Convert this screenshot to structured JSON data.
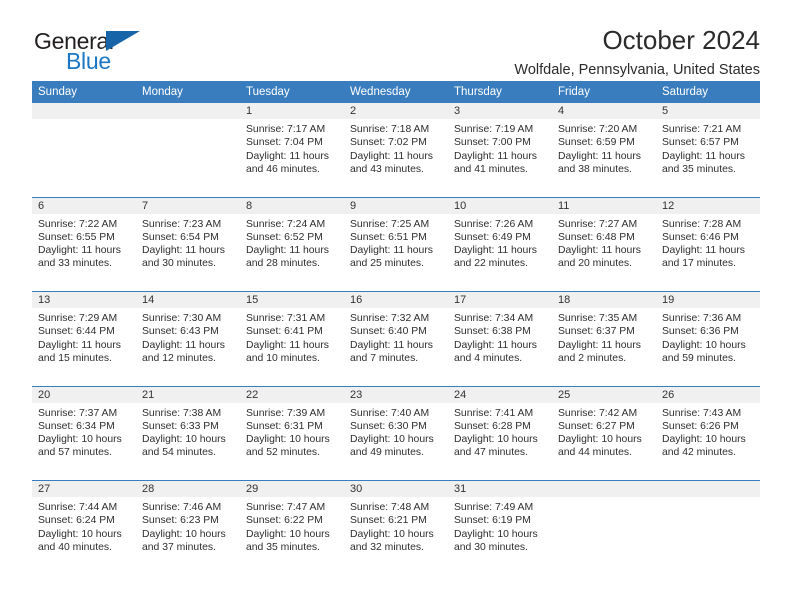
{
  "brand": {
    "name_top": "General",
    "name_bottom": "Blue",
    "accent_color": "#1b77c4",
    "triangle_color": "#1765a8"
  },
  "header": {
    "title": "October 2024",
    "subtitle": "Wolfdale, Pennsylvania, United States"
  },
  "calendar": {
    "header_bg": "#3a7dbe",
    "date_band_bg": "#f0f0f0",
    "weekdays": [
      "Sunday",
      "Monday",
      "Tuesday",
      "Wednesday",
      "Thursday",
      "Friday",
      "Saturday"
    ],
    "weeks": [
      [
        {
          "date": "",
          "empty": true,
          "sunrise": "",
          "sunset": "",
          "daylight1": "",
          "daylight2": ""
        },
        {
          "date": "",
          "empty": true,
          "sunrise": "",
          "sunset": "",
          "daylight1": "",
          "daylight2": ""
        },
        {
          "date": "1",
          "sunrise": "Sunrise: 7:17 AM",
          "sunset": "Sunset: 7:04 PM",
          "daylight1": "Daylight: 11 hours",
          "daylight2": "and 46 minutes."
        },
        {
          "date": "2",
          "sunrise": "Sunrise: 7:18 AM",
          "sunset": "Sunset: 7:02 PM",
          "daylight1": "Daylight: 11 hours",
          "daylight2": "and 43 minutes."
        },
        {
          "date": "3",
          "sunrise": "Sunrise: 7:19 AM",
          "sunset": "Sunset: 7:00 PM",
          "daylight1": "Daylight: 11 hours",
          "daylight2": "and 41 minutes."
        },
        {
          "date": "4",
          "sunrise": "Sunrise: 7:20 AM",
          "sunset": "Sunset: 6:59 PM",
          "daylight1": "Daylight: 11 hours",
          "daylight2": "and 38 minutes."
        },
        {
          "date": "5",
          "sunrise": "Sunrise: 7:21 AM",
          "sunset": "Sunset: 6:57 PM",
          "daylight1": "Daylight: 11 hours",
          "daylight2": "and 35 minutes."
        }
      ],
      [
        {
          "date": "6",
          "sunrise": "Sunrise: 7:22 AM",
          "sunset": "Sunset: 6:55 PM",
          "daylight1": "Daylight: 11 hours",
          "daylight2": "and 33 minutes."
        },
        {
          "date": "7",
          "sunrise": "Sunrise: 7:23 AM",
          "sunset": "Sunset: 6:54 PM",
          "daylight1": "Daylight: 11 hours",
          "daylight2": "and 30 minutes."
        },
        {
          "date": "8",
          "sunrise": "Sunrise: 7:24 AM",
          "sunset": "Sunset: 6:52 PM",
          "daylight1": "Daylight: 11 hours",
          "daylight2": "and 28 minutes."
        },
        {
          "date": "9",
          "sunrise": "Sunrise: 7:25 AM",
          "sunset": "Sunset: 6:51 PM",
          "daylight1": "Daylight: 11 hours",
          "daylight2": "and 25 minutes."
        },
        {
          "date": "10",
          "sunrise": "Sunrise: 7:26 AM",
          "sunset": "Sunset: 6:49 PM",
          "daylight1": "Daylight: 11 hours",
          "daylight2": "and 22 minutes."
        },
        {
          "date": "11",
          "sunrise": "Sunrise: 7:27 AM",
          "sunset": "Sunset: 6:48 PM",
          "daylight1": "Daylight: 11 hours",
          "daylight2": "and 20 minutes."
        },
        {
          "date": "12",
          "sunrise": "Sunrise: 7:28 AM",
          "sunset": "Sunset: 6:46 PM",
          "daylight1": "Daylight: 11 hours",
          "daylight2": "and 17 minutes."
        }
      ],
      [
        {
          "date": "13",
          "sunrise": "Sunrise: 7:29 AM",
          "sunset": "Sunset: 6:44 PM",
          "daylight1": "Daylight: 11 hours",
          "daylight2": "and 15 minutes."
        },
        {
          "date": "14",
          "sunrise": "Sunrise: 7:30 AM",
          "sunset": "Sunset: 6:43 PM",
          "daylight1": "Daylight: 11 hours",
          "daylight2": "and 12 minutes."
        },
        {
          "date": "15",
          "sunrise": "Sunrise: 7:31 AM",
          "sunset": "Sunset: 6:41 PM",
          "daylight1": "Daylight: 11 hours",
          "daylight2": "and 10 minutes."
        },
        {
          "date": "16",
          "sunrise": "Sunrise: 7:32 AM",
          "sunset": "Sunset: 6:40 PM",
          "daylight1": "Daylight: 11 hours",
          "daylight2": "and 7 minutes."
        },
        {
          "date": "17",
          "sunrise": "Sunrise: 7:34 AM",
          "sunset": "Sunset: 6:38 PM",
          "daylight1": "Daylight: 11 hours",
          "daylight2": "and 4 minutes."
        },
        {
          "date": "18",
          "sunrise": "Sunrise: 7:35 AM",
          "sunset": "Sunset: 6:37 PM",
          "daylight1": "Daylight: 11 hours",
          "daylight2": "and 2 minutes."
        },
        {
          "date": "19",
          "sunrise": "Sunrise: 7:36 AM",
          "sunset": "Sunset: 6:36 PM",
          "daylight1": "Daylight: 10 hours",
          "daylight2": "and 59 minutes."
        }
      ],
      [
        {
          "date": "20",
          "sunrise": "Sunrise: 7:37 AM",
          "sunset": "Sunset: 6:34 PM",
          "daylight1": "Daylight: 10 hours",
          "daylight2": "and 57 minutes."
        },
        {
          "date": "21",
          "sunrise": "Sunrise: 7:38 AM",
          "sunset": "Sunset: 6:33 PM",
          "daylight1": "Daylight: 10 hours",
          "daylight2": "and 54 minutes."
        },
        {
          "date": "22",
          "sunrise": "Sunrise: 7:39 AM",
          "sunset": "Sunset: 6:31 PM",
          "daylight1": "Daylight: 10 hours",
          "daylight2": "and 52 minutes."
        },
        {
          "date": "23",
          "sunrise": "Sunrise: 7:40 AM",
          "sunset": "Sunset: 6:30 PM",
          "daylight1": "Daylight: 10 hours",
          "daylight2": "and 49 minutes."
        },
        {
          "date": "24",
          "sunrise": "Sunrise: 7:41 AM",
          "sunset": "Sunset: 6:28 PM",
          "daylight1": "Daylight: 10 hours",
          "daylight2": "and 47 minutes."
        },
        {
          "date": "25",
          "sunrise": "Sunrise: 7:42 AM",
          "sunset": "Sunset: 6:27 PM",
          "daylight1": "Daylight: 10 hours",
          "daylight2": "and 44 minutes."
        },
        {
          "date": "26",
          "sunrise": "Sunrise: 7:43 AM",
          "sunset": "Sunset: 6:26 PM",
          "daylight1": "Daylight: 10 hours",
          "daylight2": "and 42 minutes."
        }
      ],
      [
        {
          "date": "27",
          "sunrise": "Sunrise: 7:44 AM",
          "sunset": "Sunset: 6:24 PM",
          "daylight1": "Daylight: 10 hours",
          "daylight2": "and 40 minutes."
        },
        {
          "date": "28",
          "sunrise": "Sunrise: 7:46 AM",
          "sunset": "Sunset: 6:23 PM",
          "daylight1": "Daylight: 10 hours",
          "daylight2": "and 37 minutes."
        },
        {
          "date": "29",
          "sunrise": "Sunrise: 7:47 AM",
          "sunset": "Sunset: 6:22 PM",
          "daylight1": "Daylight: 10 hours",
          "daylight2": "and 35 minutes."
        },
        {
          "date": "30",
          "sunrise": "Sunrise: 7:48 AM",
          "sunset": "Sunset: 6:21 PM",
          "daylight1": "Daylight: 10 hours",
          "daylight2": "and 32 minutes."
        },
        {
          "date": "31",
          "sunrise": "Sunrise: 7:49 AM",
          "sunset": "Sunset: 6:19 PM",
          "daylight1": "Daylight: 10 hours",
          "daylight2": "and 30 minutes."
        },
        {
          "date": "",
          "empty": true,
          "sunrise": "",
          "sunset": "",
          "daylight1": "",
          "daylight2": ""
        },
        {
          "date": "",
          "empty": true,
          "sunrise": "",
          "sunset": "",
          "daylight1": "",
          "daylight2": ""
        }
      ]
    ]
  }
}
